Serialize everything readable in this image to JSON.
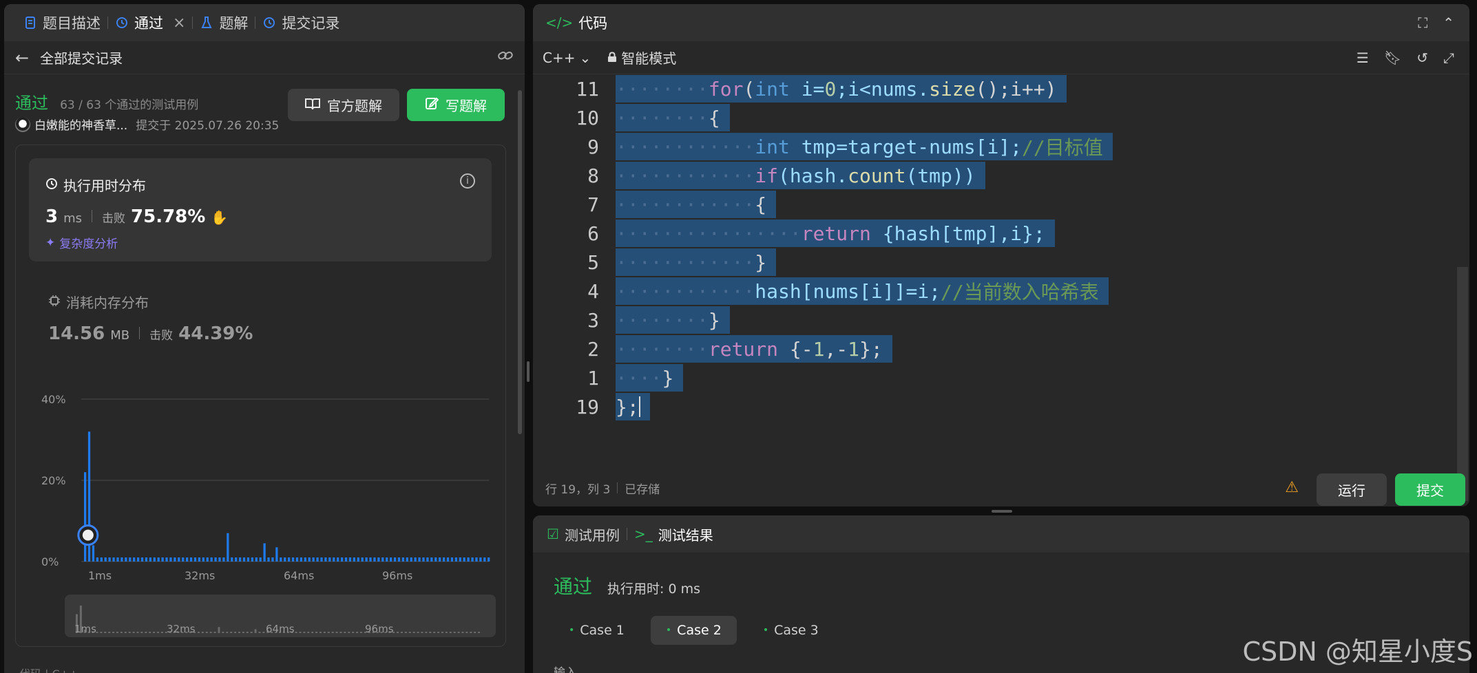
{
  "left_tabs": [
    {
      "label": "题目描述",
      "icon": "document-icon"
    },
    {
      "label": "通过",
      "icon": "history-icon"
    },
    {
      "label": "题解",
      "icon": "flask-icon"
    },
    {
      "label": "提交记录",
      "icon": "history-icon"
    }
  ],
  "subbar": {
    "title": "全部提交记录"
  },
  "submission": {
    "status": "通过",
    "cases": "63 / 63 个通过的测试用例",
    "author": "白嫩能的神香草...",
    "submitted_at": "提交于 2025.07.26 20:35",
    "official_btn": "官方题解",
    "write_btn": "写题解"
  },
  "runtime": {
    "title": "执行用时分布",
    "value": "3",
    "unit": "ms",
    "beat_label": "击败",
    "beat_value": "75.78%",
    "complexity": "复杂度分析"
  },
  "memory": {
    "title": "消耗内存分布",
    "value": "14.56",
    "unit": "MB",
    "beat_label": "击败",
    "beat_value": "44.39%"
  },
  "chart_data": {
    "type": "bar",
    "title": "",
    "ylim": [
      0,
      40
    ],
    "y_ticks": [
      "40%",
      "20%",
      "0%"
    ],
    "x_ticks": [
      "1ms",
      "32ms",
      "64ms",
      "96ms"
    ],
    "mini_x_ticks": [
      "1ms",
      "32ms",
      "64ms",
      "96ms"
    ],
    "values": [
      22,
      32,
      4,
      1,
      1,
      1,
      1,
      1,
      1,
      1,
      1,
      1,
      1,
      1,
      1,
      1,
      1,
      1,
      1,
      1,
      1,
      1,
      1,
      1,
      1,
      1,
      1,
      1,
      1,
      1,
      1,
      1,
      1,
      1,
      1,
      7,
      1,
      1,
      1,
      1,
      1,
      1,
      1,
      1,
      4.5,
      1,
      1,
      3.5,
      1,
      1,
      1,
      1,
      1,
      1,
      1,
      1,
      1,
      1,
      1,
      1,
      1,
      1,
      1,
      1,
      1,
      1,
      1,
      1,
      1,
      1,
      1,
      1,
      1,
      1,
      1,
      1,
      1,
      1,
      1,
      1,
      1,
      1,
      1,
      1,
      1,
      1,
      1,
      1,
      1,
      1,
      1,
      1,
      1,
      1,
      1,
      1,
      1,
      1,
      1,
      1
    ],
    "highlight_index": 2,
    "grid": true
  },
  "code_panel": {
    "title": "代码",
    "language": "C++",
    "mode": "智能模式",
    "lines": [
      {
        "num": "11",
        "indent": 2
      },
      {
        "num": "10",
        "indent": 2
      },
      {
        "num": "9",
        "indent": 3
      },
      {
        "num": "8",
        "indent": 3
      },
      {
        "num": "7",
        "indent": 3
      },
      {
        "num": "6",
        "indent": 4
      },
      {
        "num": "5",
        "indent": 3
      },
      {
        "num": "4",
        "indent": 3
      },
      {
        "num": "3",
        "indent": 2
      },
      {
        "num": "2",
        "indent": 2
      },
      {
        "num": "1",
        "indent": 1
      },
      {
        "num": "19",
        "indent": 0
      }
    ],
    "cursor": "行 19，列 3",
    "saved": "已存储",
    "run_btn": "运行",
    "submit_btn": "提交"
  },
  "code_text": {
    "l11": [
      "for",
      "(",
      "int",
      " i=",
      "0",
      ";i<nums.",
      "size",
      "();i++)"
    ],
    "l10": "{",
    "l9": [
      "int",
      " tmp=target-nums[i];",
      "//目标值"
    ],
    "l8": [
      "if",
      "(hash.",
      "count",
      "(tmp))"
    ],
    "l7": "{",
    "l6": [
      "return",
      " {hash[tmp],i};"
    ],
    "l5": "}",
    "l4": [
      "hash[nums[i]]=i;",
      "//当前数入哈希表"
    ],
    "l3": "}",
    "l2": [
      "return",
      " {-",
      "1",
      ",-",
      "1",
      "};"
    ],
    "l1": "}",
    "l19": "};"
  },
  "test_panel": {
    "tab_cases": "测试用例",
    "tab_result": "测试结果",
    "result": "通过",
    "time": "执行用时: 0 ms",
    "cases": [
      "Case 1",
      "Case 2",
      "Case 3"
    ],
    "active_case": 1,
    "input_label": "输入"
  },
  "watermark": "CSDN @知星小度S",
  "colors": {
    "accent_green": "#2cbb5d",
    "accent_blue": "#3b82f6",
    "selection": "#264f78"
  }
}
